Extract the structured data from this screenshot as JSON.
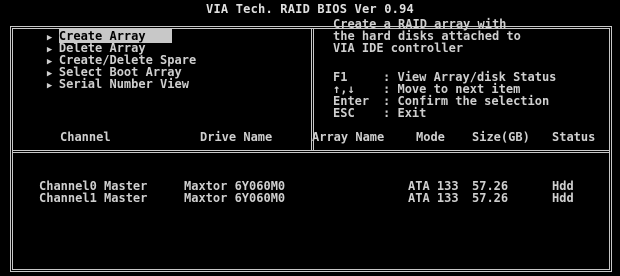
{
  "title": "VIA Tech. RAID BIOS Ver 0.94",
  "menu": {
    "items": [
      {
        "label": "Create Array",
        "selected": true
      },
      {
        "label": "Delete Array",
        "selected": false
      },
      {
        "label": "Create/Delete Spare",
        "selected": false
      },
      {
        "label": "Select Boot Array",
        "selected": false
      },
      {
        "label": "Serial Number View",
        "selected": false
      }
    ]
  },
  "help": {
    "description": [
      "Create a RAID array with",
      "the hard disks attached to",
      "VIA IDE controller"
    ],
    "keys": [
      {
        "key": "F1",
        "sep": ":",
        "desc": "View Array/disk Status"
      },
      {
        "key": "↑,↓",
        "sep": ":",
        "desc": "Move to next item"
      },
      {
        "key": "Enter",
        "sep": ":",
        "desc": "Confirm the selection"
      },
      {
        "key": "ESC",
        "sep": ":",
        "desc": "Exit"
      }
    ]
  },
  "table": {
    "headers": [
      "Channel",
      "Drive Name",
      "Array Name",
      "Mode",
      "Size(GB)",
      "Status"
    ],
    "rows": [
      [
        "Channel0 Master",
        "Maxtor 6Y060M0",
        "",
        "ATA 133",
        "57.26",
        "Hdd"
      ],
      [
        "Channel1 Master",
        "Maxtor 6Y060M0",
        "",
        "ATA 133",
        "57.26",
        "Hdd"
      ]
    ]
  }
}
